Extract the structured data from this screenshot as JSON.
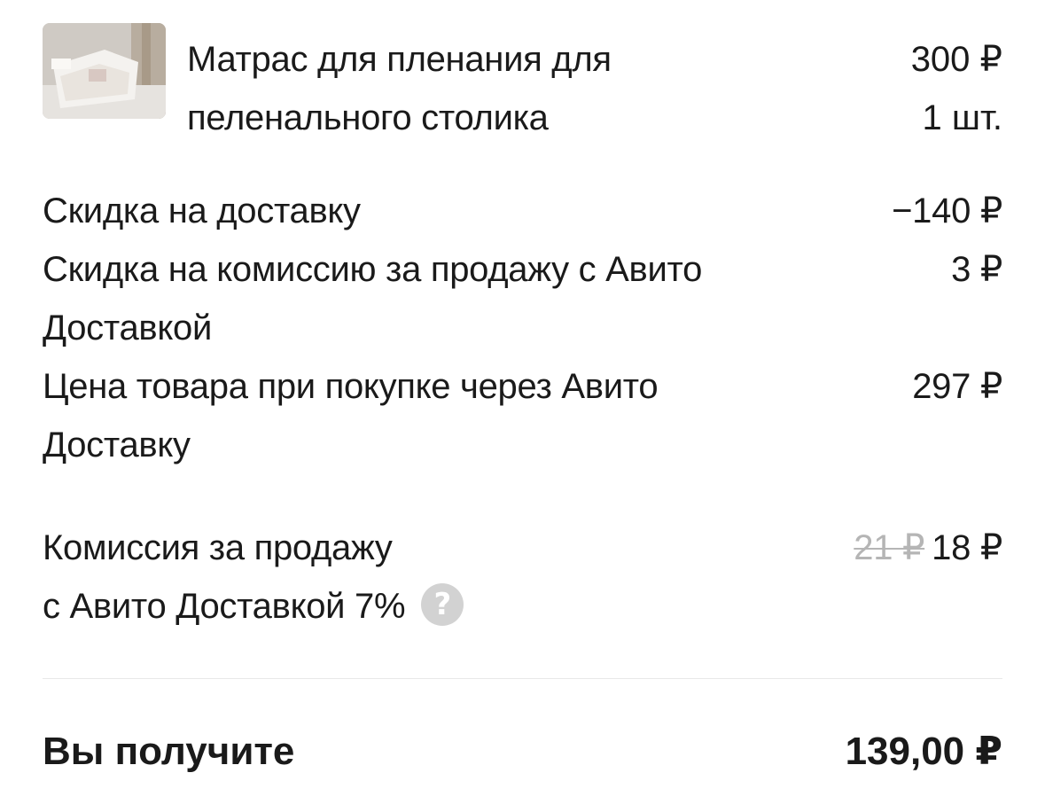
{
  "product": {
    "title_line1": "Матрас для пленания для",
    "title_line2": "пеленального столика",
    "price": "300 ₽",
    "quantity": "1 шт.",
    "thumbnail_icon": "product-photo"
  },
  "breakdown": [
    {
      "label": "Скидка на доставку",
      "value": "−140 ₽"
    },
    {
      "label_line1": "Скидка на комиссию за продажу с Авито",
      "label_line2": "Доставкой",
      "value": "3 ₽"
    },
    {
      "label_line1": "Цена товара при покупке через Авито",
      "label_line2": "Доставку",
      "value": "297 ₽"
    }
  ],
  "commission": {
    "label_line1": "Комиссия за продажу",
    "label_line2": "с Авито Доставкой 7%",
    "old_value": "21 ₽",
    "value": "18 ₽",
    "help_icon": "?"
  },
  "total": {
    "label": "Вы получите",
    "value": "139,00 ₽"
  }
}
